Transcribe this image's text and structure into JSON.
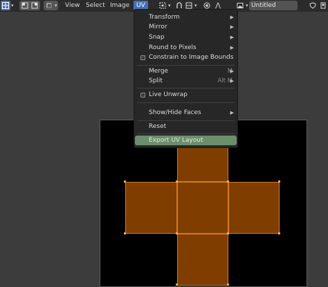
{
  "header": {
    "menus": {
      "view": "View",
      "select": "Select",
      "image": "Image",
      "uv": "UV"
    },
    "image_name": "Untitled"
  },
  "uv_menu": {
    "transform": "Transform",
    "mirror": "Mirror",
    "snap": "Snap",
    "round_to_pixels": "Round to Pixels",
    "constrain": "Constrain to Image Bounds",
    "merge": "Merge",
    "merge_shortcut": "M",
    "split": "Split",
    "split_shortcut": "Alt M",
    "live_unwrap": "Live Unwrap",
    "show_hide": "Show/Hide Faces",
    "reset": "Reset",
    "export": "Export UV Layout"
  },
  "colors": {
    "accent": "#4772b3",
    "face_fill": "#7f3e00",
    "face_edge": "#d97a1a",
    "highlight": "#6b8e6b"
  },
  "icons": [
    "editor-type-icon",
    "select-mode-icons",
    "uv-sync-icon",
    "pivot-icon",
    "snap-icon",
    "proportional-icon",
    "image-icon",
    "shield-icon",
    "new-image-icon"
  ]
}
